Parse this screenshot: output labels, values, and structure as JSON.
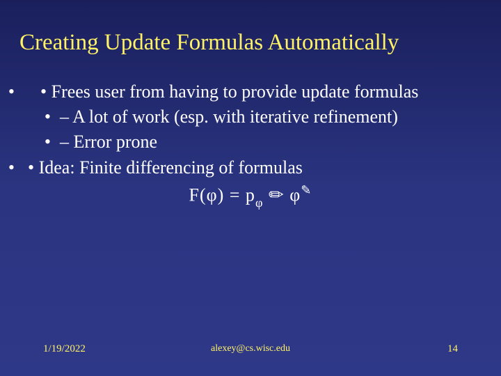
{
  "title": "Creating Update Formulas Automatically",
  "bullets": {
    "b1": "Frees user from having to provide update formulas",
    "b1a": "A lot of work (esp. with iterative refinement)",
    "b1b": "Error prone",
    "b2": "Idea: Finite differencing of formulas"
  },
  "formula": {
    "lhs": "F(φ) = p",
    "sub": "φ",
    "mid": " ",
    "sym1": "✏",
    "gap": " ",
    "phi2": "φ",
    "sym2": "✎"
  },
  "footer": {
    "date": "1/19/2022",
    "email": "alexey@cs.wisc.edu",
    "page": "14"
  }
}
